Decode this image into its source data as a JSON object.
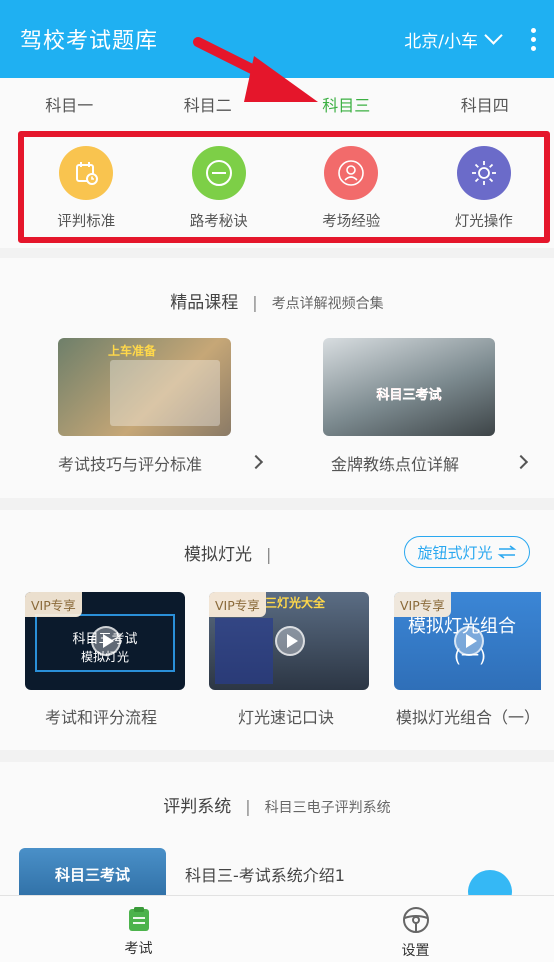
{
  "header": {
    "title": "驾校考试题库",
    "city": "北京/小车"
  },
  "tabs": [
    {
      "label": "科目一",
      "active": false
    },
    {
      "label": "科目二",
      "active": false
    },
    {
      "label": "科目三",
      "active": true
    },
    {
      "label": "科目四",
      "active": false
    }
  ],
  "quick_actions": [
    {
      "label": "评判标准",
      "icon": "calendar-clock-icon",
      "color": "#f9c44f"
    },
    {
      "label": "路考秘诀",
      "icon": "minus-circle-icon",
      "color": "#7dcf47"
    },
    {
      "label": "考场经验",
      "icon": "person-icon",
      "color": "#f26b6b"
    },
    {
      "label": "灯光操作",
      "icon": "sun-icon",
      "color": "#6b6bc9"
    }
  ],
  "premium": {
    "title": "精品课程",
    "subtitle": "考点详解视频合集",
    "items": [
      {
        "caption": "考试技巧与评分标准",
        "thumb_title": "上车准备"
      },
      {
        "caption": "金牌教练点位详解",
        "thumb_title": "科目三考试"
      }
    ]
  },
  "lights": {
    "title": "模拟灯光",
    "knob_button": "旋钮式灯光",
    "vip_badge": "VIP专享",
    "items": [
      {
        "caption": "考试和评分流程",
        "thumb_line1": "科目三考试",
        "thumb_line2": "模拟灯光"
      },
      {
        "caption": "灯光速记口诀",
        "thumb_line1": "三灯光大全"
      },
      {
        "caption": "模拟灯光组合（一）",
        "thumb_line1": "模拟灯光组合",
        "thumb_line2": "(一)"
      }
    ]
  },
  "judging": {
    "title": "评判系统",
    "subtitle": "科目三电子评判系统",
    "item_title": "科目三-考试系统介绍1",
    "thumb_text": "科目三考试"
  },
  "bottom_nav": [
    {
      "label": "考试",
      "icon": "clipboard-icon",
      "active": true
    },
    {
      "label": "设置",
      "icon": "steering-wheel-icon",
      "active": false
    }
  ],
  "colors": {
    "header": "#1fb0f2",
    "active_tab": "#3cb043",
    "annotation": "#e5162b"
  }
}
